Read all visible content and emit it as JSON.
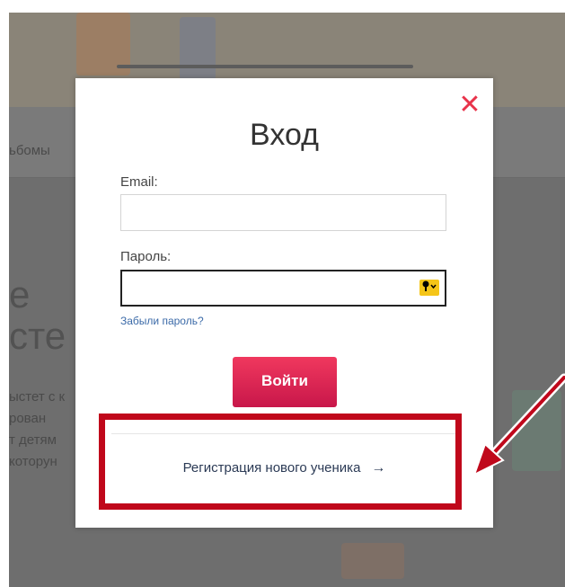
{
  "background": {
    "nav_fragment": "ьбомы",
    "heading_fragments": [
      "e",
      "сте"
    ],
    "text_fragments": [
      "ыстет с к",
      "рован",
      "т детям",
      "которун"
    ]
  },
  "modal": {
    "title": "Вход",
    "close_symbol": "✕",
    "email_label": "Email:",
    "email_value": "",
    "password_label": "Пароль:",
    "password_value": "",
    "key_icon": "key-icon",
    "forgot_link": "Забыли пароль?",
    "login_button": "Войти",
    "register_link": "Регистрация нового ученика",
    "register_arrow": "→"
  },
  "colors": {
    "accent": "#e8334a",
    "button": "#d91f4f",
    "annotation": "#c0081b"
  }
}
